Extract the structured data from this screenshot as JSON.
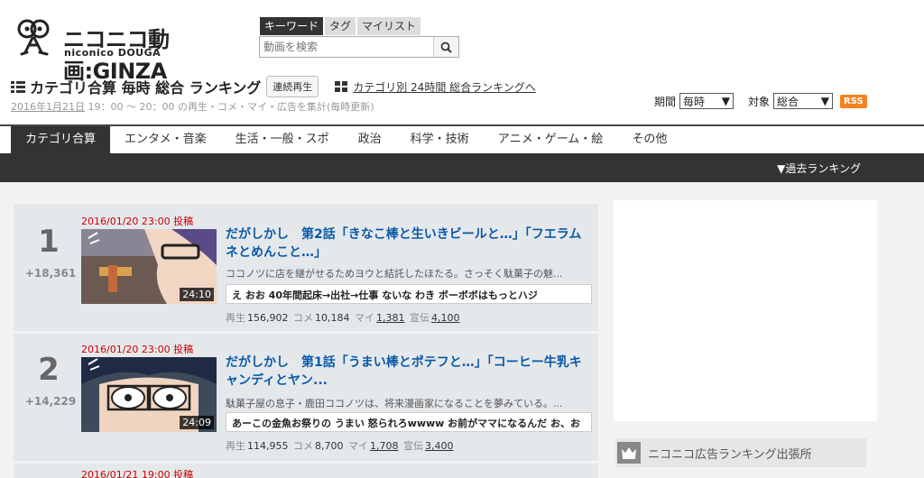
{
  "header": {
    "logo_text": "ニコニコ動画:GINZA",
    "logo_sub": "niconico DOUGA",
    "search_tabs": [
      "キーワード",
      "タグ",
      "マイリスト"
    ],
    "search_placeholder": "動画を検索"
  },
  "title": {
    "main": "カテゴリ合算 毎時 総合 ランキング",
    "continuous_play": "連続再生",
    "category_24h_link": "カテゴリ別 24時間 総合ランキングへ",
    "subline_date": "2016年1月21日",
    "subline_rest": " 19：00 ～ 20：00 の再生・コメ・マイ・広告を集計(毎時更新)"
  },
  "filters": {
    "period_label": "期間",
    "period_value": "毎時",
    "target_label": "対象",
    "target_value": "総合",
    "rss": "RSS"
  },
  "nav": {
    "items": [
      "カテゴリ合算",
      "エンタメ・音楽",
      "生活・一般・スポ",
      "政治",
      "科学・技術",
      "アニメ・ゲーム・絵",
      "その他"
    ],
    "past_ranking": "▼過去ランキング"
  },
  "ranking": [
    {
      "rank": "1",
      "diff": "+18,361",
      "posted": "2016/01/20 23:00 投稿",
      "duration": "24:10",
      "title": "だがしかし　第2話「きなこ棒と生いきビールと…」「フエラムネとめんこと…」",
      "desc": "ココノツに店を継がせるためヨウと結託したほたる。さっそく駄菓子の魅...",
      "comment": "え おお 40年間起床→出社→仕事 ないな わき ボーボボはもっとハジ",
      "stats": {
        "play_label": "再生",
        "play": "156,902",
        "comment_label": "コメ",
        "comment": "10,184",
        "mylist_label": "マイ",
        "mylist": "1,381",
        "ad_label": "宣伝",
        "ad": "4,100"
      }
    },
    {
      "rank": "2",
      "diff": "+14,229",
      "posted": "2016/01/20 23:00 投稿",
      "duration": "24:09",
      "title": "だがしかし　第1話「うまい棒とポテフと…」「コーヒー牛乳キャンディとヤン...",
      "desc": "駄菓子屋の息子・鹿田ココノツは、将来漫画家になることを夢みている。...",
      "comment": "あーこの金魚お祭りの うまい 怒られろwwww お前がママになるんだ お、お",
      "stats": {
        "play_label": "再生",
        "play": "114,955",
        "comment_label": "コメ",
        "comment": "8,700",
        "mylist_label": "マイ",
        "mylist": "1,708",
        "ad_label": "宣伝",
        "ad": "3,400"
      }
    },
    {
      "posted": "2016/01/21 19:00 投稿"
    }
  ],
  "sidebar": {
    "ad_ranking": "ニコニコ広告ランキング出張所"
  }
}
